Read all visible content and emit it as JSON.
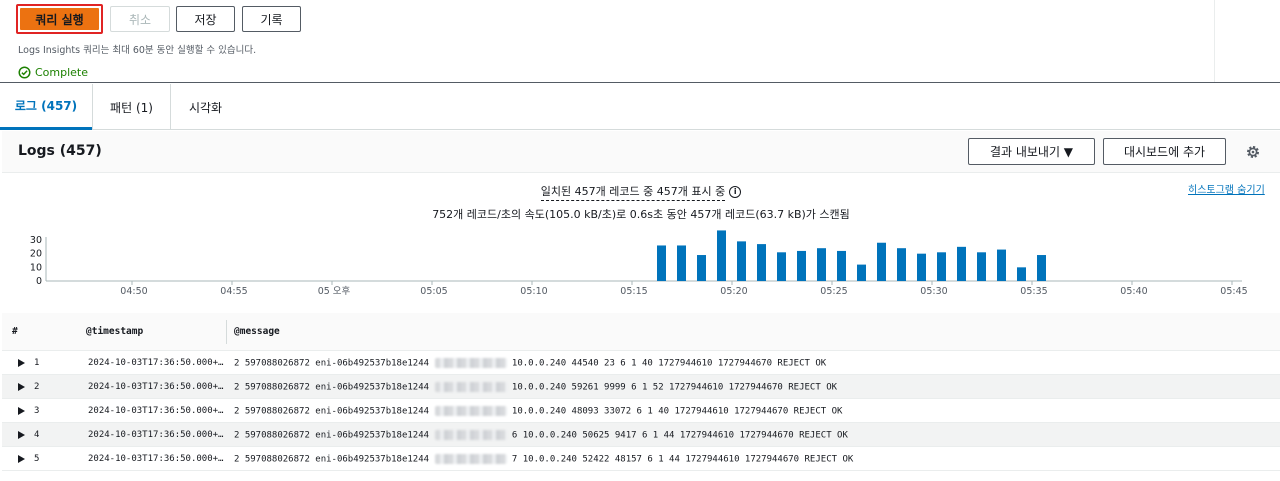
{
  "toolbar": {
    "run_label": "쿼리 실행",
    "cancel_label": "취소",
    "save_label": "저장",
    "history_label": "기록",
    "hint": "Logs Insights 쿼리는 최대 60분 동안 실행할 수 있습니다.",
    "status": "Complete"
  },
  "tabs": [
    {
      "label": "로그 (457)",
      "active": true
    },
    {
      "label": "패턴 (1)",
      "active": false
    },
    {
      "label": "시각화",
      "active": false
    }
  ],
  "logs": {
    "title": "Logs (457)",
    "export_label": "결과 내보내기 ▼",
    "add_dashboard_label": "대시보드에 추가",
    "summary_line1": "일치된 457개 레코드 중 457개 표시 중",
    "summary_line2": "752개 레코드/초의 속도(105.0 kB/초)로 0.6s초 동안 457개 레코드(63.7 kB)가 스캔됨",
    "hide_histogram": "히스토그램 숨기기"
  },
  "chart_data": {
    "type": "bar",
    "y_ticks": [
      "30",
      "20",
      "10",
      "0"
    ],
    "ylim": [
      0,
      35
    ],
    "x_tick_labels": [
      "04:50",
      "04:55",
      "05 오후",
      "05:05",
      "05:10",
      "05:15",
      "05:20",
      "05:25",
      "05:30",
      "05:35",
      "05:40",
      "05:45"
    ],
    "x_tick_minutes": [
      0,
      5,
      10,
      15,
      20,
      25,
      30,
      35,
      40,
      45,
      50,
      55
    ],
    "bars": {
      "minutes": [
        28,
        29,
        30,
        31,
        32,
        33,
        34,
        35,
        36,
        37,
        38,
        39,
        40,
        41,
        42,
        43,
        44,
        45,
        46,
        47
      ],
      "values": [
        26,
        26,
        19,
        37,
        29,
        27,
        21,
        22,
        24,
        22,
        12,
        28,
        24,
        20,
        21,
        25,
        21,
        23,
        10,
        19
      ]
    },
    "color": "#0073bb"
  },
  "table": {
    "columns": [
      "#",
      "@timestamp",
      "@message"
    ],
    "rows": [
      {
        "index": "1",
        "timestamp": "2024-10-03T17:36:50.000+…",
        "msg_prefix": "2 597088026872 eni-06b492537b18e1244",
        "msg_suffix": "10.0.0.240 44540 23 6 1 40 1727944610 1727944670 REJECT OK"
      },
      {
        "index": "2",
        "timestamp": "2024-10-03T17:36:50.000+…",
        "msg_prefix": "2 597088026872 eni-06b492537b18e1244",
        "msg_suffix": "10.0.0.240 59261 9999 6 1 52 1727944610 1727944670 REJECT OK"
      },
      {
        "index": "3",
        "timestamp": "2024-10-03T17:36:50.000+…",
        "msg_prefix": "2 597088026872 eni-06b492537b18e1244",
        "msg_suffix": "10.0.0.240 48093 33072 6 1 40 1727944610 1727944670 REJECT OK"
      },
      {
        "index": "4",
        "timestamp": "2024-10-03T17:36:50.000+…",
        "msg_prefix": "2 597088026872 eni-06b492537b18e1244",
        "msg_suffix": "6 10.0.0.240 50625 9417 6 1 44 1727944610 1727944670 REJECT OK"
      },
      {
        "index": "5",
        "timestamp": "2024-10-03T17:36:50.000+…",
        "msg_prefix": "2 597088026872 eni-06b492537b18e1244",
        "msg_suffix": "7 10.0.0.240 52422 48157 6 1 44 1727944610 1727944670 REJECT OK"
      }
    ]
  }
}
